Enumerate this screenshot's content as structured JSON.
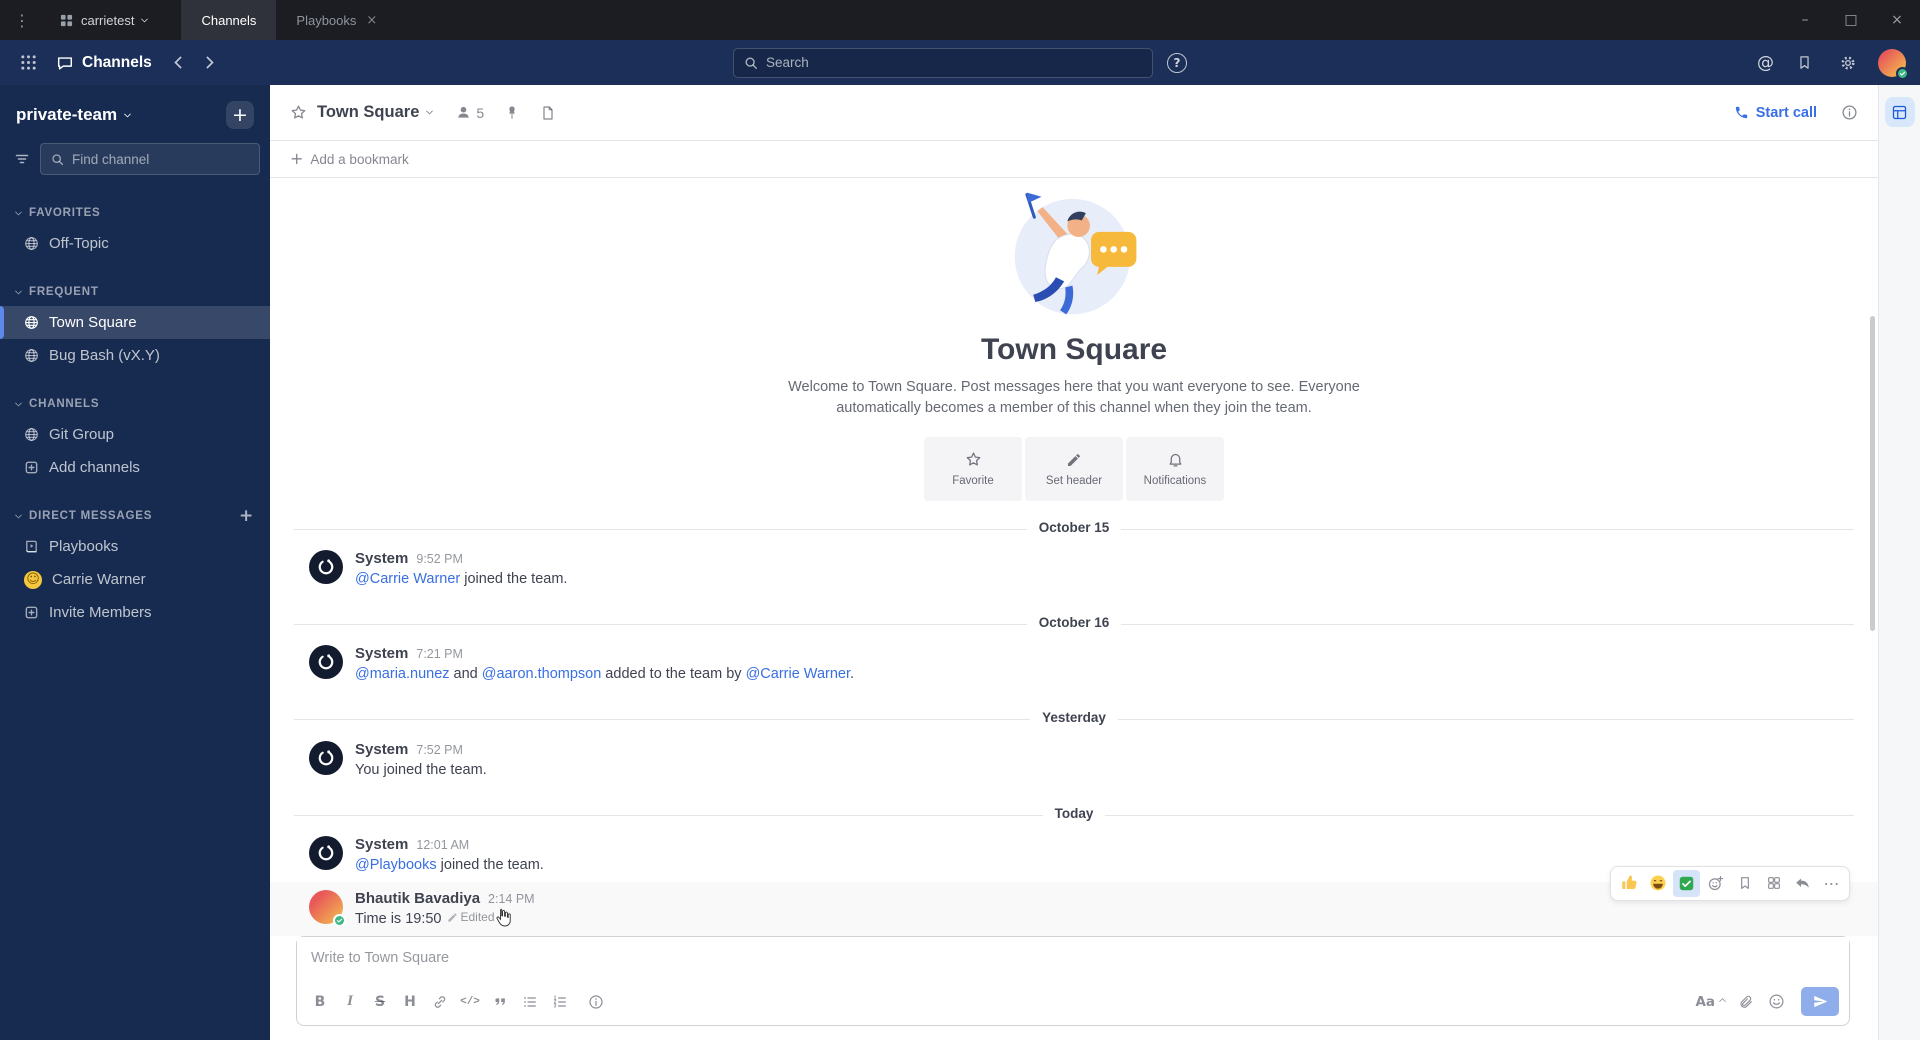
{
  "colors": {
    "header_bg": "#1b2f58",
    "sidebar_bg": "#172b50",
    "accent_blue": "#386fe5",
    "active_border": "#5d89ea",
    "online_green": "#3db887"
  },
  "glyphs": {
    "menu_dots": "⋮",
    "minimize": "–",
    "maximize": "□",
    "close": "×",
    "tab_close": "×",
    "plus": "+",
    "at_sign": "@",
    "help": "?",
    "ellipsis": "⋯",
    "bold": "B",
    "italic": "I",
    "strike": "S",
    "heading": "H",
    "code": "</>",
    "font": "Aa",
    "carrie_face": "☺"
  },
  "window": {
    "workspace": "carrietest",
    "tabs": [
      {
        "label": "Channels"
      },
      {
        "label": "Playbooks"
      }
    ]
  },
  "header": {
    "product": "Channels",
    "search_placeholder": "Search"
  },
  "sidebar": {
    "team": "private-team",
    "find_placeholder": "Find channel",
    "sections": [
      {
        "label": "FAVORITES",
        "items": [
          {
            "label": "Off-Topic"
          }
        ]
      },
      {
        "label": "FREQUENT",
        "items": [
          {
            "label": "Town Square"
          },
          {
            "label": "Bug Bash (vX.Y)"
          }
        ]
      },
      {
        "label": "CHANNELS",
        "items": [
          {
            "label": "Git Group"
          },
          {
            "label": "Add channels"
          }
        ]
      },
      {
        "label": "DIRECT MESSAGES",
        "items": [
          {
            "label": "Playbooks"
          },
          {
            "label": "Carrie Warner"
          },
          {
            "label": "Invite Members"
          }
        ]
      }
    ]
  },
  "channel": {
    "name": "Town Square",
    "member_count": "5",
    "start_call": "Start call",
    "add_bookmark": "Add a bookmark"
  },
  "intro": {
    "title": "Town Square",
    "description": "Welcome to Town Square. Post messages here that you want everyone to see. Everyone automatically becomes a member of this channel when they join the team.",
    "actions": [
      {
        "label": "Favorite"
      },
      {
        "label": "Set header"
      },
      {
        "label": "Notifications"
      }
    ]
  },
  "feed": {
    "dividers": [
      "October 15",
      "October 16",
      "Yesterday",
      "Today"
    ],
    "messages": [
      {
        "author": "System",
        "time": "9:52 PM",
        "link1": "@Carrie Warner",
        "text1": " joined the team."
      },
      {
        "author": "System",
        "time": "7:21 PM",
        "link1": "@maria.nunez",
        "text1": " and ",
        "link2": "@aaron.thompson",
        "text2": " added to the team by ",
        "link3": "@Carrie Warner",
        "text3": "."
      },
      {
        "author": "System",
        "time": "7:52 PM",
        "text1": "You joined the team."
      },
      {
        "author": "System",
        "time": "12:01 AM",
        "link1": "@Playbooks",
        "text1": " joined the team."
      },
      {
        "author": "Bhautik Bavadiya",
        "time": "2:14 PM",
        "text1": "Time is 19:50",
        "edited": "Edited"
      }
    ]
  },
  "composer": {
    "placeholder": "Write to Town Square"
  }
}
